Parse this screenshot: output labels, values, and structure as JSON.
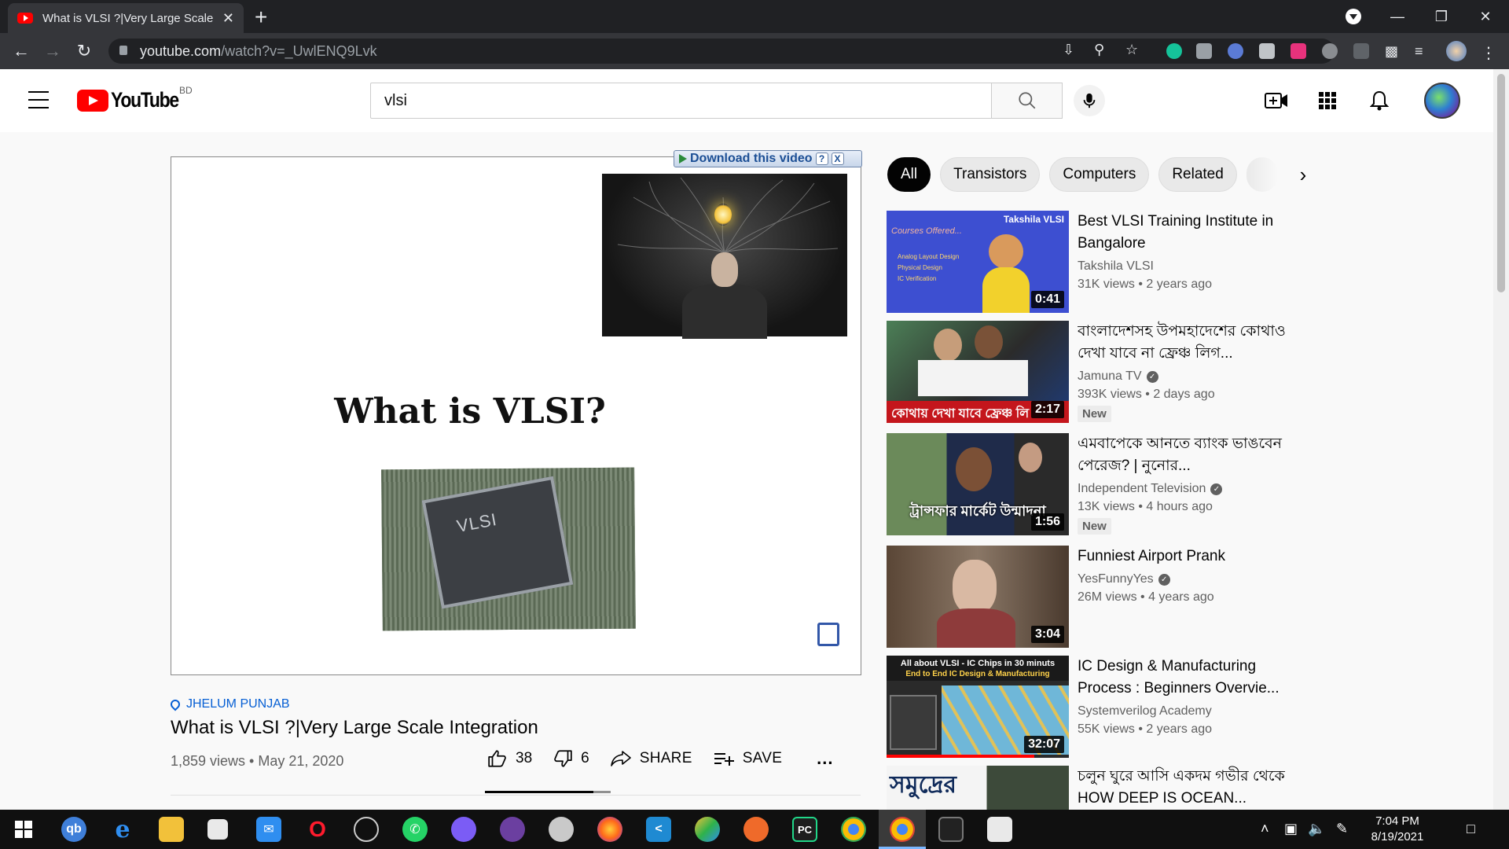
{
  "browser": {
    "tab_title": "What is VLSI ?|Very Large Scale Ir",
    "tab_close": "✕",
    "new_tab": "+",
    "url_main": "youtube.com",
    "url_path": "/watch?v=_UwlENQ9Lvk"
  },
  "youtube": {
    "logo_text": "YouTube",
    "country_code": "BD",
    "search": {
      "value": "vlsi"
    }
  },
  "player": {
    "download_label": "Download this video",
    "help": "?",
    "close": "X",
    "slide_title": "What is VLSI?",
    "chip_text": "VLSI"
  },
  "video": {
    "location": "JHELUM PUNJAB",
    "title": "What is VLSI ?|Very Large Scale Integration",
    "meta": "1,859 views • May 21, 2020",
    "likes": "38",
    "dislikes": "6",
    "share": "SHARE",
    "save": "SAVE",
    "more": "...",
    "like_ratio": 0.86
  },
  "chips": [
    "All",
    "Transistors",
    "Computers",
    "Related"
  ],
  "recommendations": [
    {
      "title": "Best VLSI Training Institute in Bangalore",
      "channel": "Takshila VLSI",
      "verified": false,
      "views": "31K views • 2 years ago",
      "duration": "0:41",
      "badge": "",
      "thumb_text": "Takshila VLSI",
      "thumb_sub": "Courses Offered...",
      "thumb_list": [
        "Analog Layout Design",
        "Physical Design",
        "IC Verification"
      ]
    },
    {
      "title": "বাংলাদেশসহ উপমহাদেশের কোথাও দেখা যাবে না ফ্রেঞ্চ লিগ...",
      "channel": "Jamuna TV",
      "verified": true,
      "views": "393K views • 2 days ago",
      "duration": "2:17",
      "badge": "New",
      "thumb_caption": "কোথায় দেখা যাবে ফ্রেঞ্চ লি"
    },
    {
      "title": "এমবাপেকে আনতে ব্যাংক ভাঙবেন পেরেজ? | নুনোর...",
      "channel": "Independent Television",
      "verified": true,
      "views": "13K views • 4 hours ago",
      "duration": "1:56",
      "badge": "New",
      "thumb_caption": "ট্রান্সফার মার্কেট উন্মাদনা"
    },
    {
      "title": "Funniest Airport Prank",
      "channel": "YesFunnyYes",
      "verified": true,
      "views": "26M views • 4 years ago",
      "duration": "3:04",
      "badge": ""
    },
    {
      "title": "IC Design & Manufacturing Process : Beginners Overvie...",
      "channel": "Systemverilog Academy",
      "verified": false,
      "views": "55K views • 2 years ago",
      "duration": "32:07",
      "badge": "",
      "thumb_text": "All about VLSI - IC Chips in 30 minuts",
      "thumb_sub": "End to End IC Design & Manufacturing"
    },
    {
      "title": "চলুন ঘুরে আসি একদম গভীর থেকে HOW DEEP IS OCEAN...",
      "channel": "",
      "verified": false,
      "views": "",
      "duration": "",
      "badge": "",
      "thumb_caption": "সমুদ্রের"
    }
  ],
  "taskbar": {
    "time": "7:04 PM",
    "date": "8/19/2021"
  },
  "colors": {
    "youtube_red": "#ff0000",
    "link_blue": "#065fd4",
    "chrome_dark": "#202124"
  }
}
